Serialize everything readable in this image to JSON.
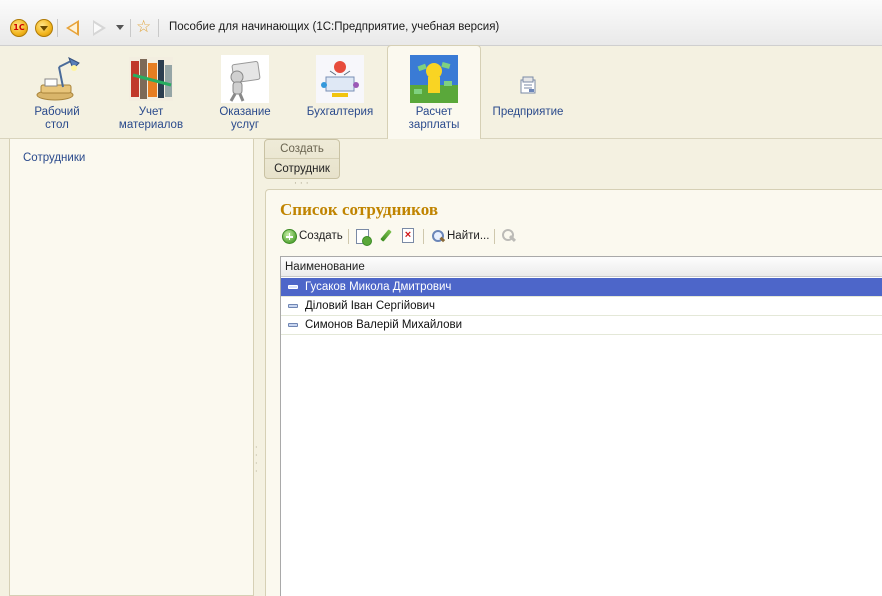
{
  "window": {
    "title": "Пособие для начинающих  (1С:Предприятие, учебная версия)",
    "logo_text": "1С"
  },
  "sections": [
    {
      "label": "Рабочий\nстол",
      "icon": "desk-lamp-icon"
    },
    {
      "label": "Учет\nматериалов",
      "icon": "materials-icon"
    },
    {
      "label": "Оказание\nуслуг",
      "icon": "services-icon"
    },
    {
      "label": "Бухгалтерия",
      "icon": "accounting-icon"
    },
    {
      "label": "Расчет\nзарплаты",
      "icon": "payroll-icon",
      "active": true
    },
    {
      "label": "Предприятие",
      "icon": "enterprise-icon"
    }
  ],
  "navigation": {
    "items": [
      "Сотрудники"
    ]
  },
  "actions": {
    "header": "Создать",
    "items": [
      "Сотрудник"
    ]
  },
  "form": {
    "title": "Список сотрудников",
    "toolbar": {
      "create_label": "Создать",
      "find_label": "Найти..."
    },
    "table": {
      "columns": [
        "Наименование"
      ],
      "rows": [
        {
          "name": "Гусаков Микола Дмитрович",
          "selected": true
        },
        {
          "name": "Діловий Іван Сергійович",
          "selected": false
        },
        {
          "name": "Симонов Валерій Михайлови",
          "selected": false
        }
      ]
    }
  },
  "colors": {
    "panel_bg": "#f4f1e1",
    "form_title": "#c08400",
    "link": "#2a4a8c",
    "selection": "#4d66c9"
  }
}
